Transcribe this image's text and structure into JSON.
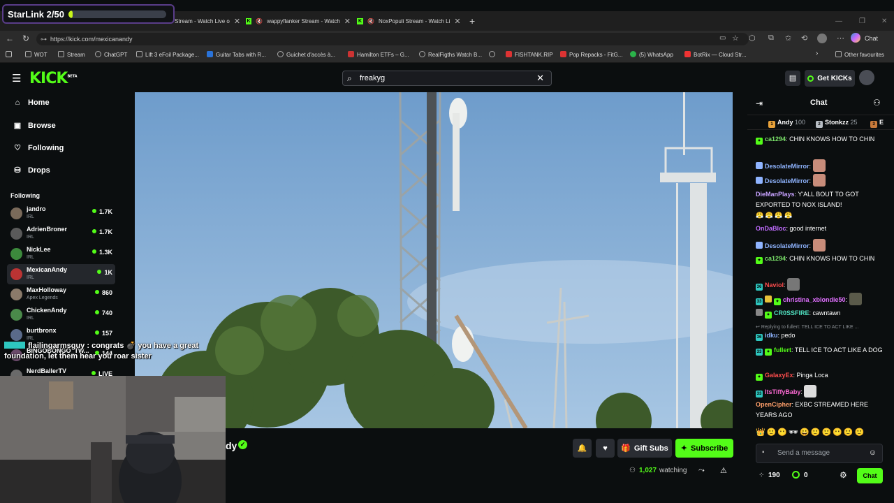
{
  "overlay": {
    "starlink_label": "StarLink 2/50",
    "starlink_progress": 0.04,
    "chat_overlay_user": "flailingarmsguy",
    "chat_overlay_text": "congrats 💣 you have a great foundation, let them hear you roar sister",
    "chat_overlay_prefix": ":"
  },
  "browser": {
    "tabs": [
      {
        "label": "Stream - Watch Live o"
      },
      {
        "label": "wappyflanker Stream - Watch"
      },
      {
        "label": "NoxPopuli Stream - Watch Li"
      }
    ],
    "new_tab": "+",
    "url": "https://kick.com/mexicanandy",
    "copilot_label": "Chat",
    "bookmarks": [
      "WOT",
      "Stream",
      "ChatGPT",
      "Lift 3 eFoil Package...",
      "Guitar Tabs with R...",
      "Guichet d'accès à...",
      "Hamilton ETFs – G...",
      "RealFigths Watch B...",
      "",
      "FISHTANK.RIP",
      "Pop Repacks - FitG...",
      "(5) WhatsApp",
      "BotRix — Cloud Str..."
    ],
    "other_favourites": "Other favourites"
  },
  "kick": {
    "logo": "KICK",
    "logo_beta": "BETA",
    "search_value": "freakyg",
    "get_kicks": "Get KICKs",
    "nav": [
      {
        "label": "Home",
        "icon": "home-icon"
      },
      {
        "label": "Browse",
        "icon": "browse-icon"
      },
      {
        "label": "Following",
        "icon": "heart-icon"
      },
      {
        "label": "Drops",
        "icon": "drops-icon"
      }
    ],
    "following_heading": "Following",
    "following": [
      {
        "name": "jandro",
        "category": "IRL",
        "viewers": "1.7K"
      },
      {
        "name": "AdrienBroner",
        "category": "IRL",
        "viewers": "1.7K"
      },
      {
        "name": "NickLee",
        "category": "IRL",
        "viewers": "1.3K"
      },
      {
        "name": "MexicanAndy",
        "category": "IRL",
        "viewers": "1K"
      },
      {
        "name": "MaxHolloway",
        "category": "Apex Legends",
        "viewers": "860"
      },
      {
        "name": "ChickenAndy",
        "category": "IRL",
        "viewers": "740"
      },
      {
        "name": "burtbronx",
        "category": "IRL",
        "viewers": "157"
      },
      {
        "name": "BINGOBONGO_TW...",
        "category": "",
        "viewers": "144"
      },
      {
        "name": "NerdBallerTV",
        "category": "",
        "viewers": "LIVE"
      }
    ],
    "streamer_name_partial": "dy",
    "gift_subs": "Gift Subs",
    "subscribe": "Subscribe",
    "watching_count": "1,027",
    "watching_label": "watching"
  },
  "chat": {
    "title": "Chat",
    "leaderboard": [
      {
        "name": "Andy",
        "score": "100"
      },
      {
        "name": "Stonkzz",
        "score": "25"
      }
    ],
    "messages": [
      {
        "user": "ca1294",
        "color": "#7be36a",
        "text": "CHIN KNOWS HOW TO CHIN"
      },
      {
        "user": "DesolateMirror",
        "color": "#8fb4ff",
        "text": ""
      },
      {
        "user": "DesolateMirror",
        "color": "#8fb4ff",
        "text": ""
      },
      {
        "user": "DieManPlays",
        "color": "#c7a2ff",
        "text": "Y'ALL BOUT TO GOT EXPORTED TO NOX ISLAND!"
      },
      {
        "user": "OnDaBloc",
        "color": "#c06cff",
        "text": "good internet"
      },
      {
        "user": "DesolateMirror",
        "color": "#8fb4ff",
        "text": ""
      },
      {
        "user": "ca1294",
        "color": "#7be36a",
        "text": "CHIN KNOWS HOW TO CHIN"
      },
      {
        "user": "Naviol",
        "color": "#ff4d4d",
        "text": ""
      },
      {
        "user": "christina_xblondie50",
        "color": "#e070ff",
        "text": ""
      },
      {
        "user": "CR0SSFIRE",
        "color": "#50e0c0",
        "text": "cawntawn"
      },
      {
        "reply": "Replying to fullert: TELL ICE TO ACT LIKE ..."
      },
      {
        "user": "idku",
        "color": "#8fb4ff",
        "text": "pedo"
      },
      {
        "user": "fullert",
        "color": "#53fc18",
        "text": "TELL ICE TO ACT LIKE A DOG"
      },
      {
        "user": "GalaxyEx",
        "color": "#ff4d4d",
        "text": "Pinga Loca"
      },
      {
        "user": "ItsTiffyBaby",
        "color": "#ff6ad5",
        "text": ""
      },
      {
        "user": "OpenCipher",
        "color": "#ff9f6a",
        "text": "EXBC STREAMED HERE YEARS AGO"
      }
    ],
    "input_placeholder": "Send a message",
    "kicks_count": "190",
    "points_count": "0",
    "send_label": "Chat"
  }
}
